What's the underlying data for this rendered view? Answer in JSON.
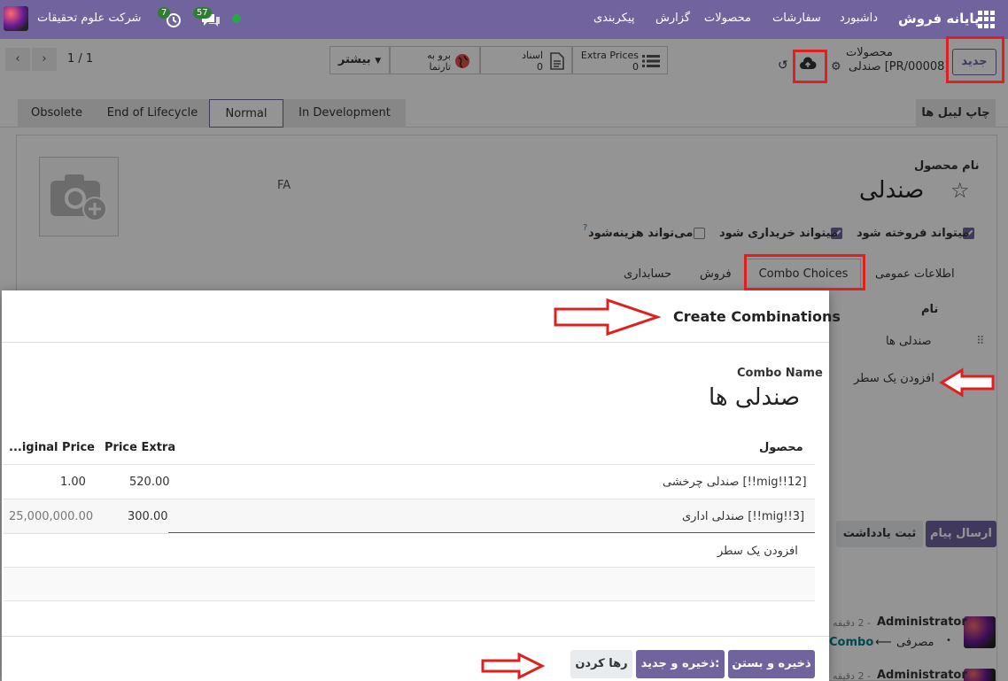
{
  "navbar": {
    "app_name": "پایانه فروش",
    "menu": [
      "داشبورد",
      "سفارشات",
      "محصولات",
      "گزارش",
      "پیکربندی"
    ],
    "company": "شرکت علوم تحقیقات",
    "activity_count": "7",
    "message_count": "57"
  },
  "control": {
    "new_button": "جدید",
    "breadcrumb_parent": "محصولات",
    "record_name": "[PR/00008] صندلی",
    "extra_prices_label": "Extra Prices",
    "extra_prices_count": "0",
    "documents_label": "اسناد",
    "documents_count": "0",
    "website_label_1": "برو به",
    "website_label_2": "تارنما",
    "more_label": "بیشتر",
    "pager": "1 / 1"
  },
  "header": {
    "print_labels": "چاپ لیبل ها",
    "stages": [
      "In Development",
      "Normal",
      "End of Lifecycle",
      "Obsolete"
    ]
  },
  "form": {
    "name_label": "نام محصول",
    "name_value": "صندلی",
    "lang": "FA",
    "can_sell": "میتواند فروخته شود",
    "can_purchase": "میتواند خریداری شود",
    "can_expense": "می‌تواند هزینه‌شود",
    "help_mark": "?",
    "tabs": [
      "اطلاعات عمومی",
      "Combo Choices",
      "فروش",
      "حسابداری"
    ],
    "combo_list_header": "نام",
    "combo_rows": [
      "صندلی ها"
    ],
    "add_line": "افزودن یک سطر"
  },
  "chatter": {
    "send_message": "ارسال پیام",
    "log_note": "ثبت یادداشت",
    "messages": [
      {
        "author": "Administrator",
        "time": "- 2 دقیقه",
        "detail_from": "مصرفی",
        "detail_to": "Combo"
      },
      {
        "author": "Administrator",
        "time": "- 2 دقیقه"
      }
    ]
  },
  "dialog": {
    "title": "Create Combinations",
    "combo_name_label": "Combo Name",
    "combo_name_value": "صندلی ها",
    "columns": {
      "product": "محصول",
      "price_extra": "Price Extra",
      "original_price": "...iginal Price"
    },
    "rows": [
      {
        "product": "[mig!!12!!] صندلی چرخشی",
        "price_extra": "520.00",
        "original_price": "1.00"
      },
      {
        "product": "[mig!!3!!] صندلی اداری",
        "price_extra": "300.00",
        "original_price": "25,000,000.00"
      }
    ],
    "add_line": "افزودن یک سطر",
    "btn_save_close": "ذخیره و بستن",
    "btn_save_new": "ذخیره و جدید:",
    "btn_discard": "رها کردن"
  },
  "colors": {
    "brand": "#71639e",
    "annotation": "#e02020",
    "online": "#28a745"
  }
}
